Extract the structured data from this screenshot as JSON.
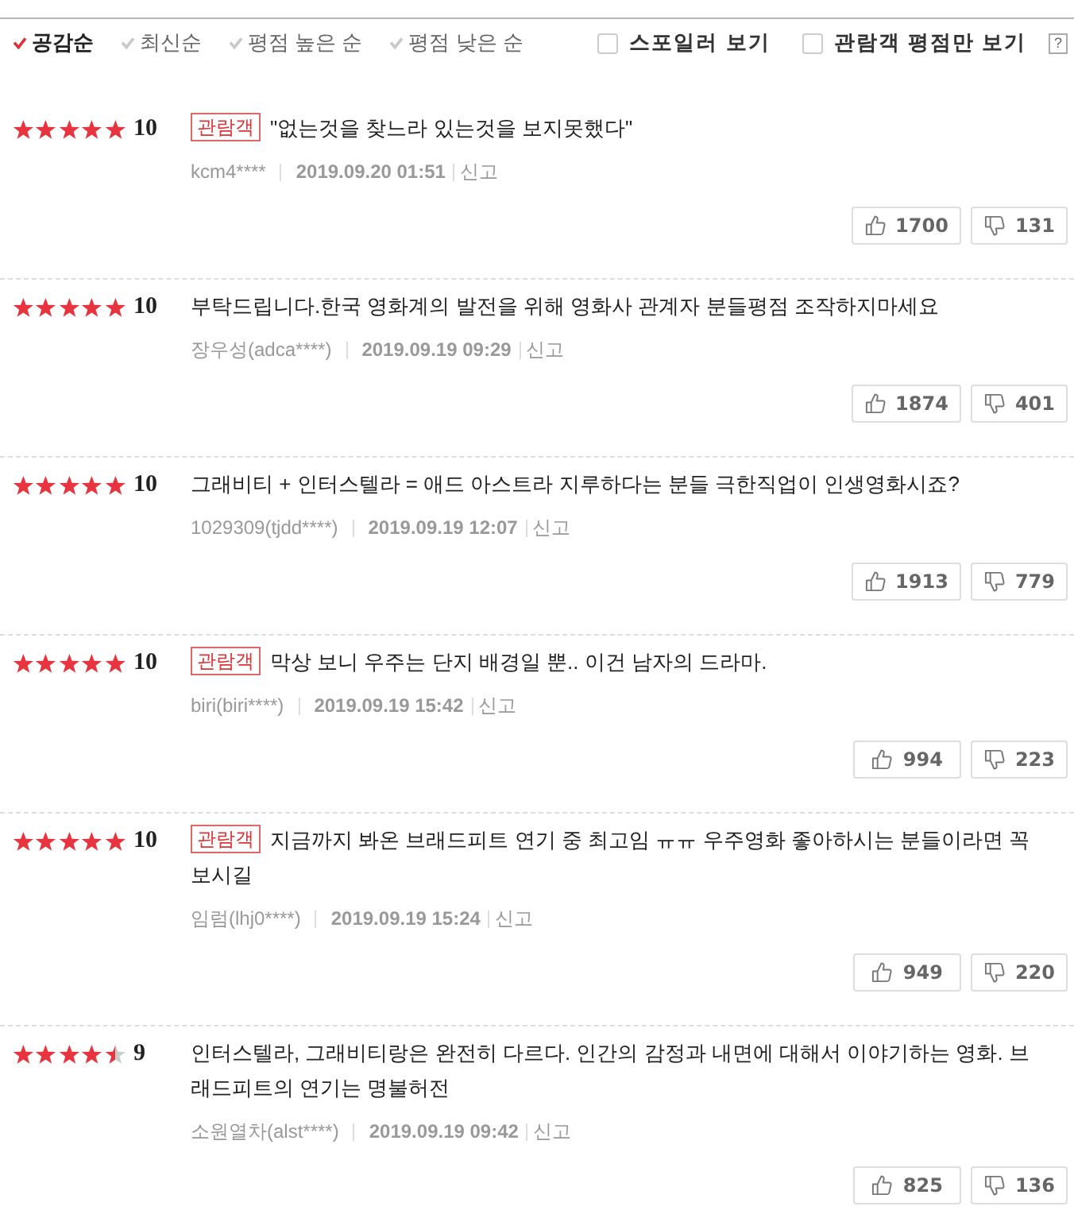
{
  "sort_options": [
    {
      "label": "공감순",
      "selected": true
    },
    {
      "label": "최신순",
      "selected": false
    },
    {
      "label": "평점 높은 순",
      "selected": false
    },
    {
      "label": "평점 낮은 순",
      "selected": false
    }
  ],
  "filters": [
    {
      "label": "스포일러 보기",
      "checked": false
    },
    {
      "label": "관람객 평점만 보기",
      "checked": false
    }
  ],
  "help": {
    "label": "?"
  },
  "reviews": [
    {
      "stars": 5,
      "score": "10",
      "badge": "관람객",
      "text": "\"없는것을 찾느라 있는것을 보지못했다\"",
      "author": "kcm4****",
      "date": "2019.09.20 01:51",
      "report": "신고",
      "likes": "1700",
      "dislikes": "131"
    },
    {
      "stars": 5,
      "score": "10",
      "text": "부탁드립니다.한국 영화계의 발전을 위해 영화사 관계자 분들평점 조작하지마세요",
      "author": "장우성(adca****)",
      "date": "2019.09.19 09:29",
      "report": "신고",
      "likes": "1874",
      "dislikes": "401"
    },
    {
      "stars": 5,
      "score": "10",
      "text": "그래비티 + 인터스텔라 = 애드 아스트라 지루하다는 분들 극한직업이 인생영화시죠?",
      "author": "1029309(tjdd****)",
      "date": "2019.09.19 12:07",
      "report": "신고",
      "likes": "1913",
      "dislikes": "779"
    },
    {
      "stars": 5,
      "score": "10",
      "badge": "관람객",
      "text": "막상 보니 우주는 단지 배경일 뿐.. 이건 남자의 드라마.",
      "author": "biri(biri****)",
      "date": "2019.09.19 15:42",
      "report": "신고",
      "likes": "994",
      "dislikes": "223"
    },
    {
      "stars": 5,
      "score": "10",
      "badge": "관람객",
      "text": "지금까지 봐온 브래드피트 연기 중 최고임 ㅠㅠ 우주영화 좋아하시는 분들이라면 꼭 보시길",
      "author": "임럼(lhj0****)",
      "date": "2019.09.19 15:24",
      "report": "신고",
      "likes": "949",
      "dislikes": "220"
    },
    {
      "stars": 4.5,
      "score": "9",
      "text": "인터스텔라, 그래비티랑은 완전히 다르다. 인간의 감정과 내면에 대해서 이야기하는 영화. 브래드피트의 연기는 명불허전",
      "author": "소원열차(alst****)",
      "date": "2019.09.19 09:42",
      "report": "신고",
      "likes": "825",
      "dislikes": "136"
    }
  ]
}
